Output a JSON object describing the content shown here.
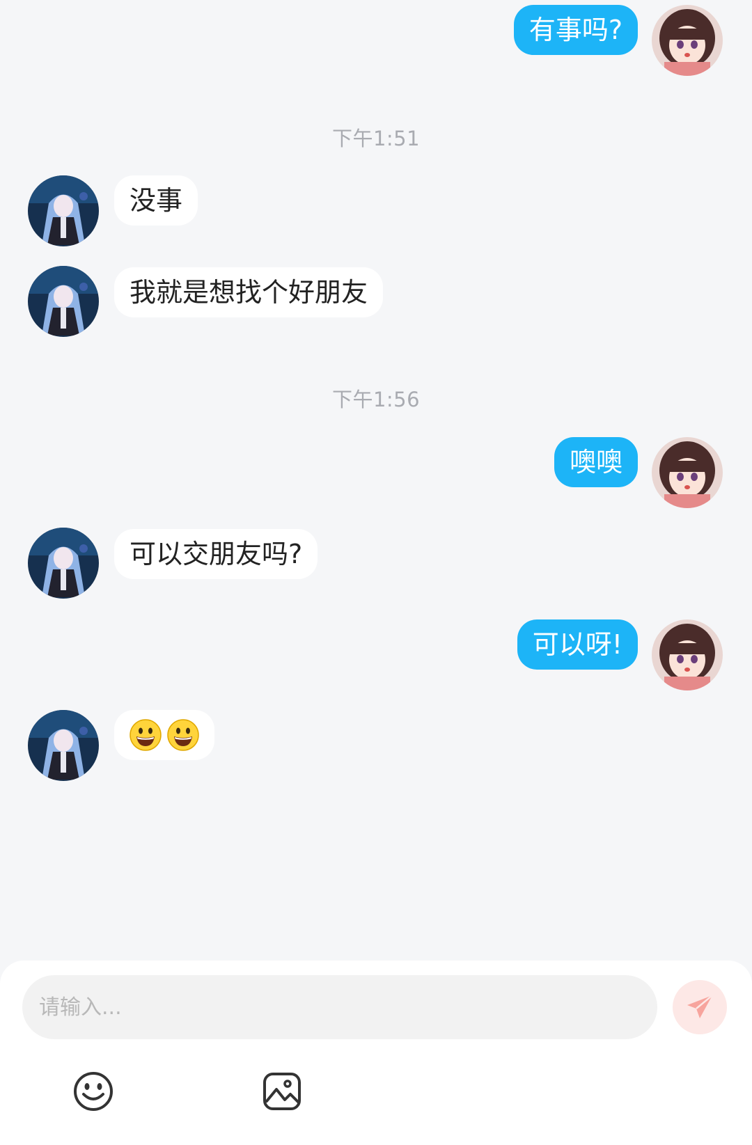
{
  "messages": [
    {
      "side": "right",
      "type": "text",
      "text": "有事吗?"
    },
    {
      "type": "time",
      "text": "下午1:51"
    },
    {
      "side": "left",
      "type": "text",
      "text": "没事"
    },
    {
      "side": "left",
      "type": "text",
      "text": "我就是想找个好朋友"
    },
    {
      "type": "time",
      "text": "下午1:56"
    },
    {
      "side": "right",
      "type": "text",
      "text": "噢噢"
    },
    {
      "side": "left",
      "type": "text",
      "text": "可以交朋友吗?"
    },
    {
      "side": "right",
      "type": "text",
      "text": "可以呀!"
    },
    {
      "side": "left",
      "type": "emoji",
      "icons": [
        "grinning-face-icon",
        "grinning-face-icon"
      ]
    }
  ],
  "composer": {
    "placeholder": "请输入...",
    "send_icon": "paper-plane-icon",
    "tools": [
      "emoji-icon",
      "image-icon"
    ]
  },
  "colors": {
    "background": "#f5f6f8",
    "outgoing_bubble": "#1db4f7",
    "incoming_bubble": "#ffffff",
    "send_button_disabled": "#fde8e6",
    "send_icon": "#f7a49d"
  }
}
